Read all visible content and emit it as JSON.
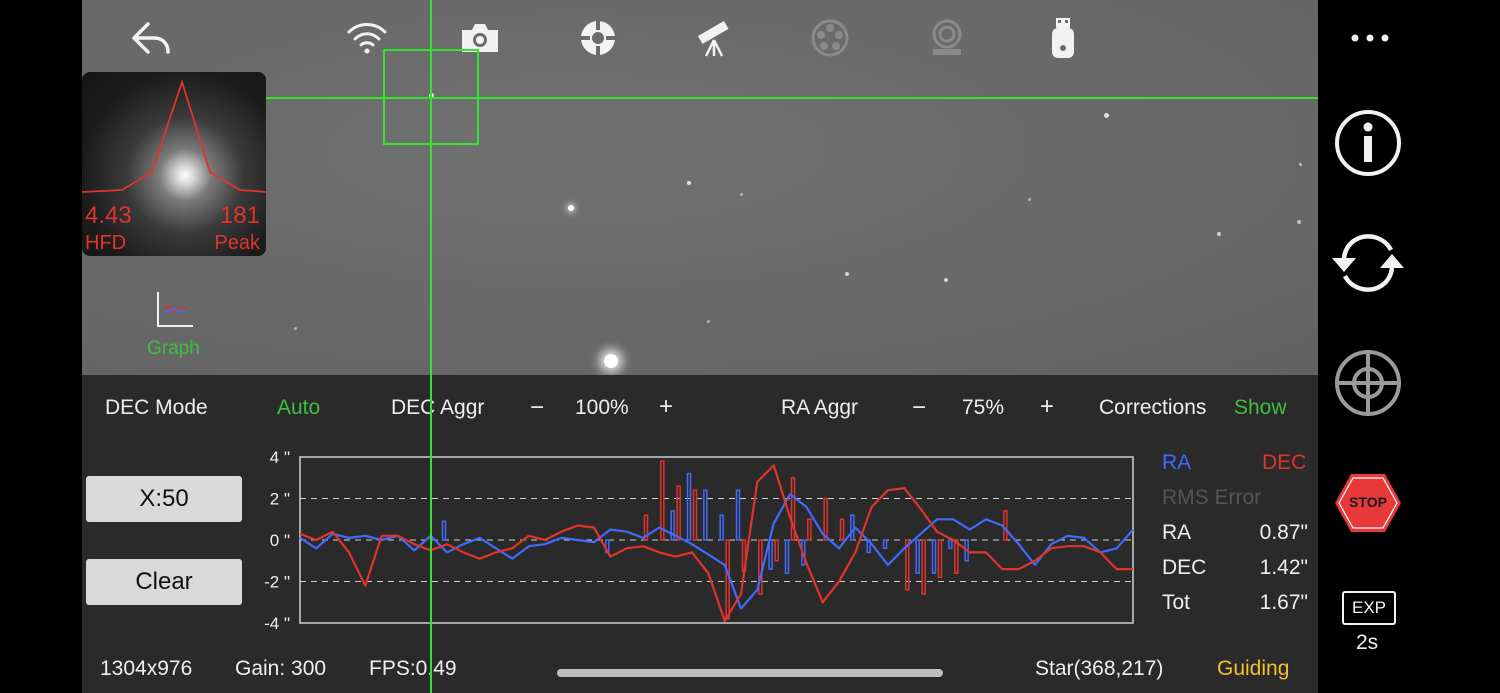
{
  "hfd": {
    "value": "4.43",
    "label": "HFD",
    "peak_value": "181",
    "peak_label": "Peak"
  },
  "graph_button": {
    "label": "Graph"
  },
  "toolbar": {
    "icons": [
      "back-icon",
      "wifi-icon",
      "camera-icon",
      "guide-target-icon",
      "telescope-icon",
      "filter-wheel-icon",
      "rotator-icon",
      "usb-drive-icon"
    ]
  },
  "controls": {
    "dec_mode_label": "DEC Mode",
    "dec_mode_value": "Auto",
    "dec_aggr_label": "DEC Aggr",
    "dec_aggr_minus": "−",
    "dec_aggr_value": "100%",
    "dec_aggr_plus": "+",
    "ra_aggr_label": "RA Aggr",
    "ra_aggr_minus": "−",
    "ra_aggr_value": "75%",
    "ra_aggr_plus": "+",
    "corrections_label": "Corrections",
    "corrections_value": "Show"
  },
  "buttons": {
    "scale_label": "X:50",
    "clear_label": "Clear"
  },
  "legend": {
    "ra": "RA",
    "dec": "DEC",
    "rms_title": "RMS Error",
    "ra_label": "RA",
    "ra_value": "0.87\"",
    "dec_label": "DEC",
    "dec_value": "1.42\"",
    "tot_label": "Tot",
    "tot_value": "1.67\""
  },
  "status": {
    "resolution": "1304x976",
    "gain": "Gain: 300",
    "fps": "FPS:0.49",
    "star": "Star(368,217)",
    "state": "Guiding"
  },
  "right": {
    "exp_label": "EXP",
    "exp_value": "2s",
    "stop_label": "STOP"
  },
  "colors": {
    "ra": "#3f6cff",
    "dec": "#e0342c",
    "accent_green": "#3fbf3f",
    "status_yellow": "#f2c12e",
    "stop_red": "#e8393a"
  },
  "chart_data": {
    "type": "line",
    "yticks": [
      "4 \"",
      "2 \"",
      "0 \"",
      "-2 \"",
      "-4 \""
    ],
    "ylim": [
      -4,
      4
    ],
    "grid": true,
    "series": [
      {
        "name": "RA",
        "values": [
          0.1,
          -0.4,
          0.3,
          0.1,
          0.2,
          0.0,
          0.2,
          -0.5,
          0.2,
          -0.6,
          -0.2,
          0.1,
          -0.4,
          -0.9,
          -0.3,
          -0.2,
          0.1,
          0.0,
          -0.1,
          0.5,
          0.4,
          0.1,
          0.6,
          0.2,
          -0.2,
          -0.7,
          -1.2,
          -3.3,
          -2.4,
          0.8,
          2.2,
          1.6,
          0.3,
          -0.4,
          0.6,
          -0.2,
          -1.2,
          -0.4,
          0.3,
          1.0,
          1.0,
          0.5,
          1.0,
          0.7,
          -0.2,
          -1.2,
          -0.2,
          0.2,
          0.1,
          -0.6,
          -0.4,
          0.5
        ]
      },
      {
        "name": "DEC",
        "values": [
          0.3,
          0.0,
          0.4,
          -0.6,
          -2.2,
          0.2,
          0.2,
          -0.2,
          -0.5,
          -0.2,
          -0.6,
          -0.9,
          -0.6,
          -0.4,
          0.2,
          0.0,
          0.4,
          0.7,
          0.6,
          -0.8,
          -0.4,
          -0.3,
          -0.6,
          -0.8,
          -0.6,
          -1.6,
          -3.9,
          -2.6,
          2.8,
          3.6,
          1.1,
          -1.1,
          -3.0,
          -2.0,
          -0.6,
          1.6,
          2.4,
          2.5,
          1.5,
          0.4,
          0.0,
          -0.6,
          -0.6,
          -1.4,
          -1.4,
          -1.0,
          -0.4,
          -0.3,
          -0.3,
          -0.6,
          -1.4,
          -1.4
        ]
      }
    ],
    "corrections_ra": [
      {
        "i": 9,
        "v": 0.9
      },
      {
        "i": 19,
        "v": -0.6
      },
      {
        "i": 23,
        "v": 1.4
      },
      {
        "i": 24,
        "v": 3.2
      },
      {
        "i": 25,
        "v": 2.4
      },
      {
        "i": 26,
        "v": 1.2
      },
      {
        "i": 27,
        "v": 2.4
      },
      {
        "i": 29,
        "v": -1.4
      },
      {
        "i": 30,
        "v": -1.6
      },
      {
        "i": 31,
        "v": -1.2
      },
      {
        "i": 34,
        "v": 1.2
      },
      {
        "i": 35,
        "v": -0.6
      },
      {
        "i": 36,
        "v": -0.4
      },
      {
        "i": 38,
        "v": -1.6
      },
      {
        "i": 39,
        "v": -1.6
      },
      {
        "i": 40,
        "v": -0.4
      },
      {
        "i": 41,
        "v": -1.0
      }
    ],
    "corrections_dec": [
      {
        "i": 21,
        "v": 1.2
      },
      {
        "i": 22,
        "v": 3.8
      },
      {
        "i": 23,
        "v": 2.6
      },
      {
        "i": 24,
        "v": 2.4
      },
      {
        "i": 26,
        "v": -3.8
      },
      {
        "i": 27,
        "v": -1.5
      },
      {
        "i": 28,
        "v": -2.6
      },
      {
        "i": 29,
        "v": -1.0
      },
      {
        "i": 30,
        "v": 3.0
      },
      {
        "i": 31,
        "v": 1.0
      },
      {
        "i": 32,
        "v": 2.0
      },
      {
        "i": 33,
        "v": 1.0
      },
      {
        "i": 37,
        "v": -2.4
      },
      {
        "i": 38,
        "v": -2.6
      },
      {
        "i": 39,
        "v": -1.8
      },
      {
        "i": 40,
        "v": -1.6
      },
      {
        "i": 43,
        "v": 1.4
      }
    ]
  }
}
